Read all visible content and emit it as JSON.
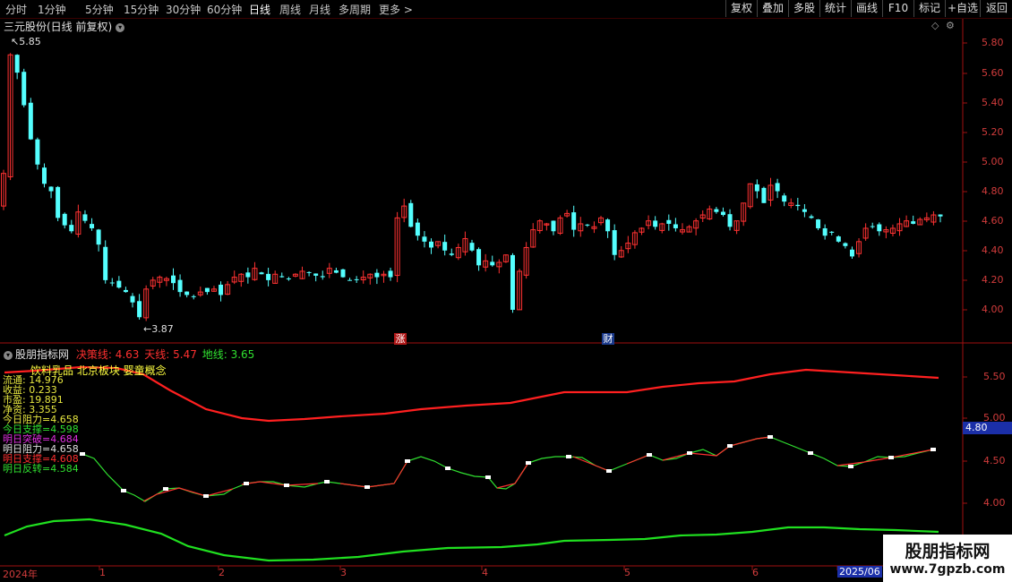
{
  "toolbar": {
    "periods": [
      "分时",
      "1分钟",
      "5分钟",
      "15分钟",
      "30分钟",
      "60分钟",
      "日线",
      "周线",
      "月线",
      "多周期",
      "更多 >"
    ],
    "active_period": "日线",
    "right_buttons": [
      "复权",
      "叠加",
      "多股",
      "统计",
      "画线",
      "F10",
      "标记",
      "+自选",
      "返回"
    ]
  },
  "main_chart": {
    "title": "三元股份(日线 前复权)",
    "high_label": "5.85",
    "low_label": "3.87",
    "y_ticks": [
      "5.80",
      "5.60",
      "5.40",
      "5.20",
      "5.00",
      "4.80",
      "4.60",
      "4.40",
      "4.20",
      "4.00"
    ],
    "event_tags": [
      "涨",
      "财"
    ]
  },
  "indicator_panel": {
    "name": "股朋指标网",
    "params": [
      {
        "label": "决策线:",
        "value": "4.63",
        "color": "#ff3030"
      },
      {
        "label": "天线:",
        "value": "5.47",
        "color": "#ff3030"
      },
      {
        "label": "地线:",
        "value": "3.65",
        "color": "#30e030"
      }
    ],
    "concepts": "饮料乳品 北京板块 婴童概念",
    "info_lines": [
      {
        "text": "流通: 14.976",
        "color": "#e8e840"
      },
      {
        "text": "收益: 0.233",
        "color": "#e8e840"
      },
      {
        "text": "市盈: 19.891",
        "color": "#e8e840"
      },
      {
        "text": "净资: 3.355",
        "color": "#e8e840"
      },
      {
        "text": "今日阻力=4.658",
        "color": "#e8e840"
      },
      {
        "text": "今日支撑=4.598",
        "color": "#30e030"
      },
      {
        "text": "明日突破=4.684",
        "color": "#e030e0"
      },
      {
        "text": "明日阻力=4.658",
        "color": "#e0e0e0"
      },
      {
        "text": "明日支撑=4.608",
        "color": "#ff3030"
      },
      {
        "text": "明日反转=4.584",
        "color": "#30e030"
      }
    ],
    "y_ticks": [
      "5.50",
      "5.00",
      "4.50",
      "4.00"
    ],
    "current_value": "4.80"
  },
  "x_axis": [
    "2024年",
    "1",
    "2",
    "3",
    "4",
    "5",
    "6",
    "2025/06"
  ],
  "watermark": {
    "title": "股朋指标网",
    "url": "www.7gpzb.com"
  },
  "colors": {
    "up": "#ff3232",
    "down": "#54ffff",
    "axis": "#a01010",
    "tian": "#ff2020",
    "di": "#20e020",
    "decision": "#ff3030",
    "mid": "#30e030"
  }
}
